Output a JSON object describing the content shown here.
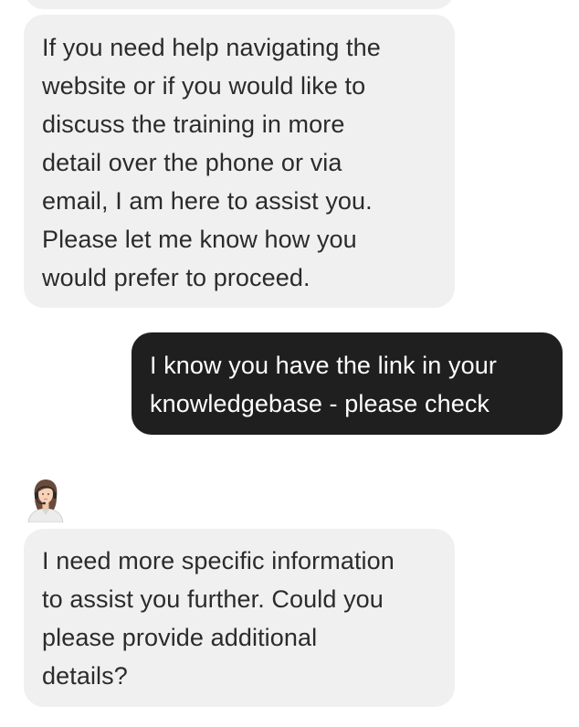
{
  "conversation": {
    "messages": [
      {
        "sender": "assistant",
        "lines": [
          "If you need help navigating the",
          "website or if you would like to",
          "discuss the training in more",
          "detail over the phone or via",
          "email, I am here to assist you.",
          "Please let me know how you",
          "would prefer to proceed."
        ]
      },
      {
        "sender": "user",
        "lines": [
          "I know you have the link in your",
          "knowledgebase - please check"
        ]
      },
      {
        "sender": "assistant",
        "avatar_icon": "support-agent-avatar-icon",
        "lines": [
          "I need more specific information",
          "to assist you further. Could you",
          "please provide additional",
          "details?"
        ]
      }
    ]
  },
  "colors": {
    "assistant_bubble": "#f0f0f0",
    "assistant_text": "#2b2b2b",
    "user_bubble": "#1f1f1f",
    "user_text": "#ffffff"
  }
}
